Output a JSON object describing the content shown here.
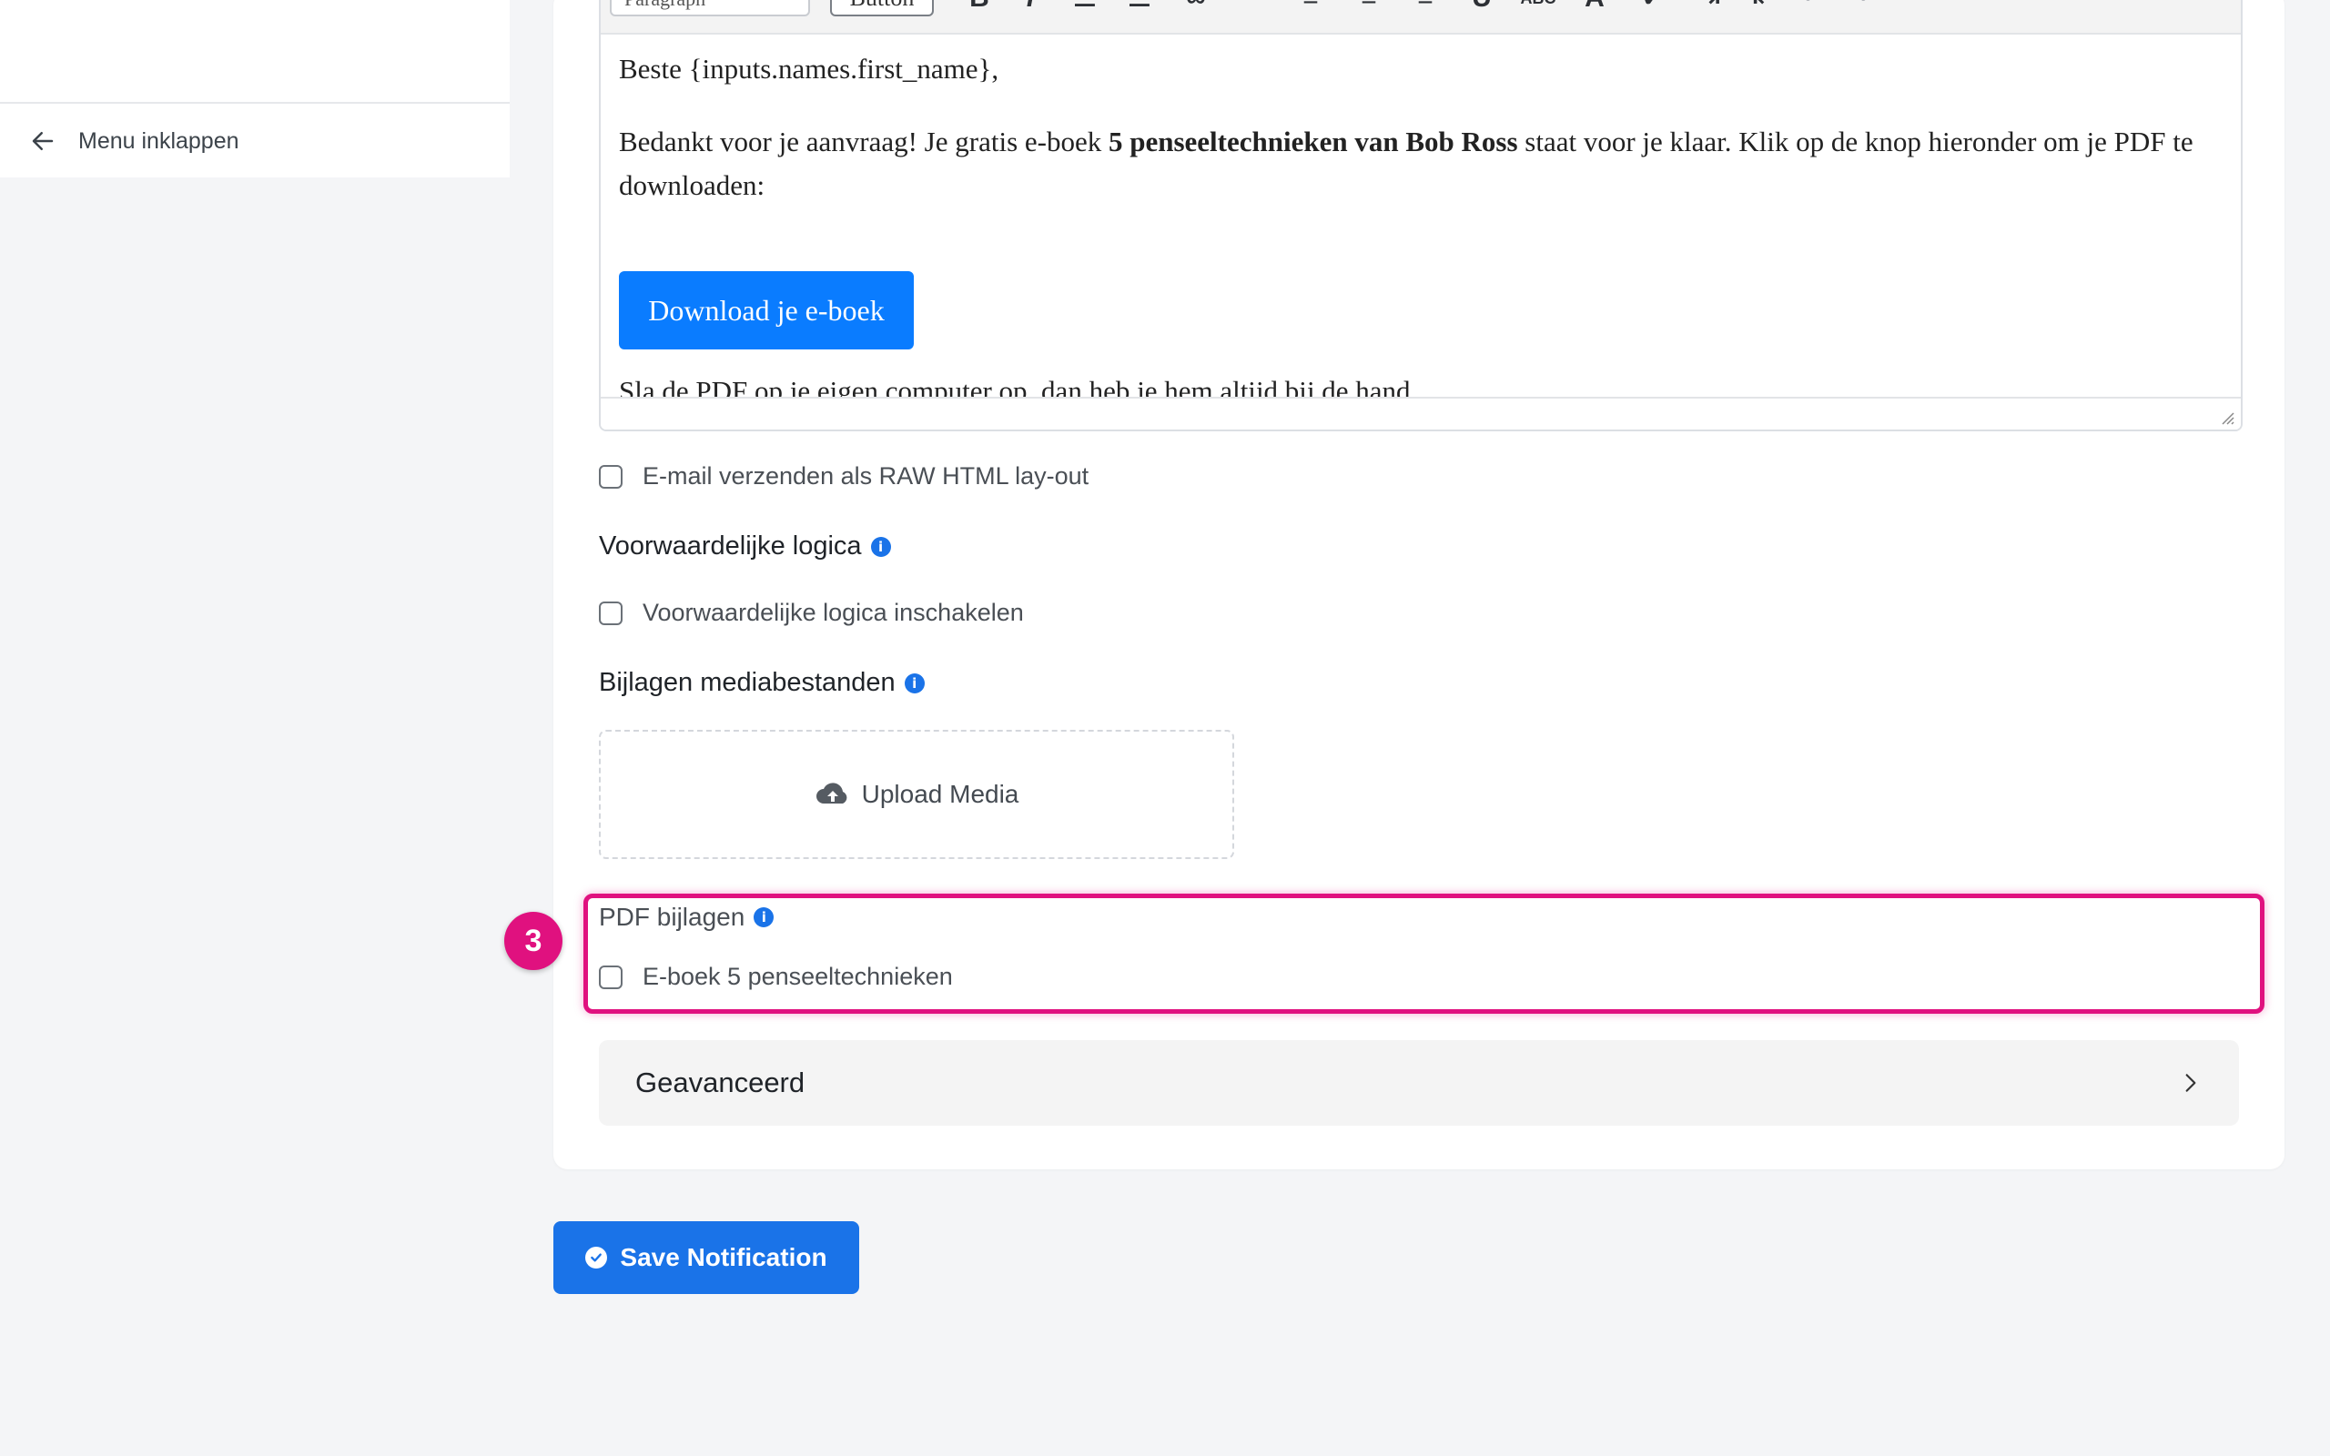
{
  "sidebar": {
    "collapse_label": "Menu inklappen"
  },
  "editor": {
    "toolbar": {
      "format_select": "Paragraph",
      "button_label": "Button"
    },
    "greeting": "Beste {inputs.names.first_name},",
    "body_before_bold": "Bedankt voor je aanvraag! Je gratis e-boek ",
    "body_bold": "5 penseeltechnieken van Bob Ross",
    "body_after_bold": " staat voor je klaar. Klik op de knop hieronder om je PDF te downloaden:",
    "download_button": "Download je e-boek",
    "closing": "Sla de PDF op je eigen computer op, dan heb je hem altijd bij de hand."
  },
  "raw_html": {
    "label": "E-mail verzenden als RAW HTML lay-out",
    "checked": false
  },
  "conditional_logic": {
    "heading": "Voorwaardelijke logica",
    "checkbox_label": "Voorwaardelijke logica inschakelen",
    "checked": false
  },
  "attachments": {
    "heading": "Bijlagen mediabestanden",
    "upload_label": "Upload Media"
  },
  "pdf_attachments": {
    "label": "PDF bijlagen",
    "step_number": "3",
    "items": [
      {
        "label": "E-boek 5 penseeltechnieken",
        "checked": false
      }
    ]
  },
  "advanced": {
    "label": "Geavanceerd"
  },
  "save_button": "Save Notification",
  "colors": {
    "primary": "#1a73e8",
    "editor_button": "#0a7cff",
    "highlight": "#e0117f",
    "info": "#1a73e8"
  }
}
